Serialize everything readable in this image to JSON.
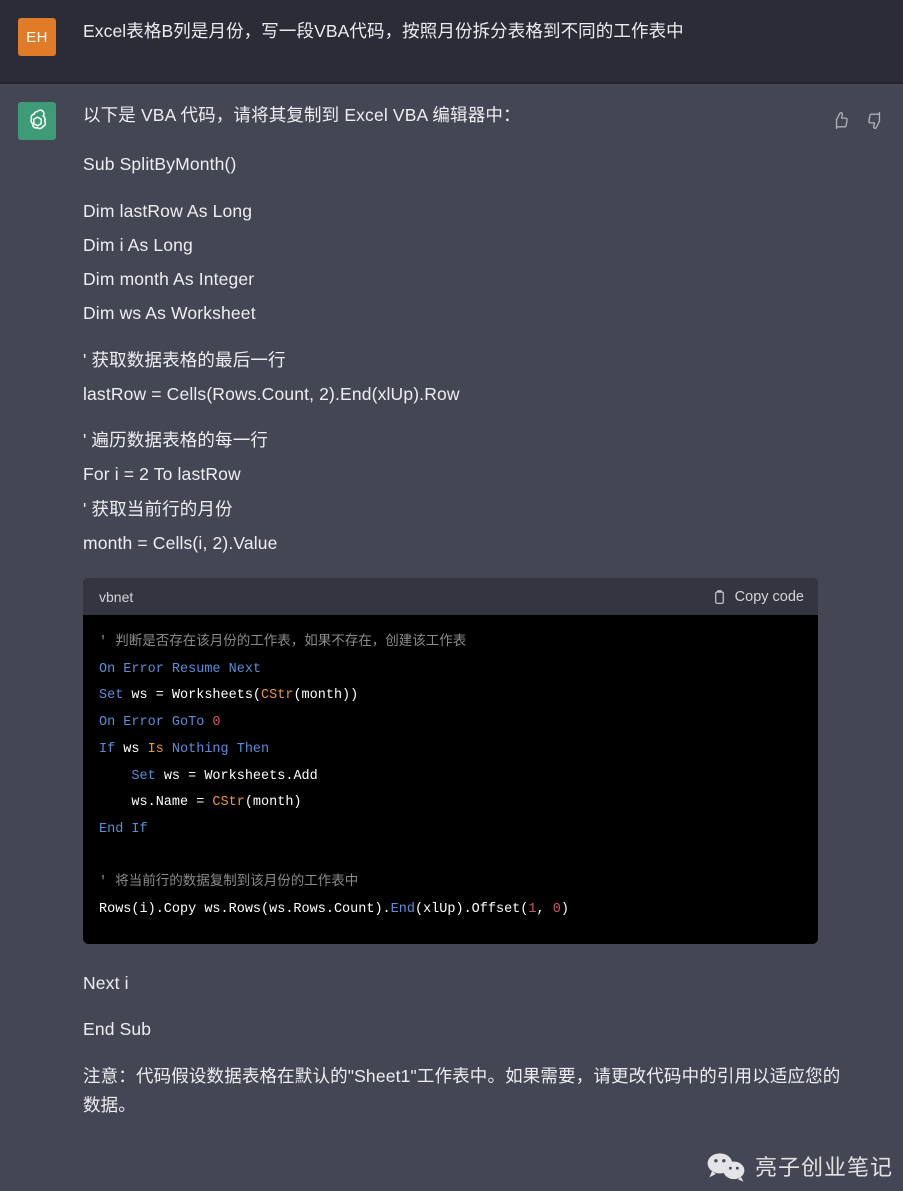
{
  "conversation": {
    "user": {
      "avatar_initials": "EH",
      "avatar_color": "#e07b28",
      "message": "Excel表格B列是月份，写一段VBA代码，按照月份拆分表格到不同的工作表中"
    },
    "assistant": {
      "avatar_color": "#3d9c77",
      "avatar_icon": "openai-logo-icon",
      "intro": "以下是 VBA 代码，请将其复制到 Excel VBA 编辑器中：",
      "paragraphs_before_code": [
        "Sub SplitByMonth()",
        "Dim lastRow As Long",
        "Dim i As Long",
        "Dim month As Integer",
        "Dim ws As Worksheet",
        "' 获取数据表格的最后一行",
        "lastRow = Cells(Rows.Count, 2).End(xlUp).Row",
        "' 遍历数据表格的每一行",
        "For i = 2 To lastRow",
        "' 获取当前行的月份",
        "month = Cells(i, 2).Value"
      ],
      "paragraphs_after_code": [
        "Next i",
        "End Sub"
      ],
      "note": "注意：代码假设数据表格在默认的\"Sheet1\"工作表中。如果需要，请更改代码中的引用以适应您的数据。",
      "feedback": {
        "thumbs_up_icon": "thumbs-up-icon",
        "thumbs_down_icon": "thumbs-down-icon"
      }
    }
  },
  "code_block": {
    "language_label": "vbnet",
    "copy_label": "Copy code",
    "copy_icon": "clipboard-icon",
    "colors": {
      "background": "#000000",
      "header_background": "#343541",
      "comment": "#8a8a8a",
      "keyword": "#5b8dd6",
      "function": "#e8973a",
      "number": "#d1556f",
      "plain": "#ffffff"
    },
    "lines": [
      [
        {
          "t": "' 判断是否存在该月份的工作表，如果不存在，创建该工作表",
          "c": "cmt"
        }
      ],
      [
        {
          "t": "On Error Resume Next",
          "c": "kw"
        }
      ],
      [
        {
          "t": "Set",
          "c": "kw"
        },
        {
          "t": " ws = Worksheets(",
          "c": "pl"
        },
        {
          "t": "CStr",
          "c": "fn"
        },
        {
          "t": "(month))",
          "c": "pl"
        }
      ],
      [
        {
          "t": "On Error GoTo ",
          "c": "kw"
        },
        {
          "t": "0",
          "c": "num"
        }
      ],
      [
        {
          "t": "If",
          "c": "kw"
        },
        {
          "t": " ws ",
          "c": "pl"
        },
        {
          "t": "Is",
          "c": "fn"
        },
        {
          "t": " ",
          "c": "pl"
        },
        {
          "t": "Nothing Then",
          "c": "kw"
        }
      ],
      [
        {
          "t": "    ",
          "c": "pl"
        },
        {
          "t": "Set",
          "c": "kw"
        },
        {
          "t": " ws = Worksheets.Add",
          "c": "pl"
        }
      ],
      [
        {
          "t": "    ws.Name = ",
          "c": "pl"
        },
        {
          "t": "CStr",
          "c": "fn"
        },
        {
          "t": "(month)",
          "c": "pl"
        }
      ],
      [
        {
          "t": "End If",
          "c": "kw"
        }
      ],
      [
        {
          "t": " ",
          "c": "pl"
        }
      ],
      [
        {
          "t": "' 将当前行的数据复制到该月份的工作表中",
          "c": "cmt"
        }
      ],
      [
        {
          "t": "Rows(i).Copy ws.Rows(ws.Rows.Count).",
          "c": "pl"
        },
        {
          "t": "End",
          "c": "kw"
        },
        {
          "t": "(xlUp).Offset(",
          "c": "pl"
        },
        {
          "t": "1",
          "c": "num"
        },
        {
          "t": ", ",
          "c": "pl"
        },
        {
          "t": "0",
          "c": "num"
        },
        {
          "t": ")",
          "c": "pl"
        }
      ]
    ]
  },
  "watermark": {
    "icon": "wechat-icon",
    "text": "亮子创业笔记"
  }
}
